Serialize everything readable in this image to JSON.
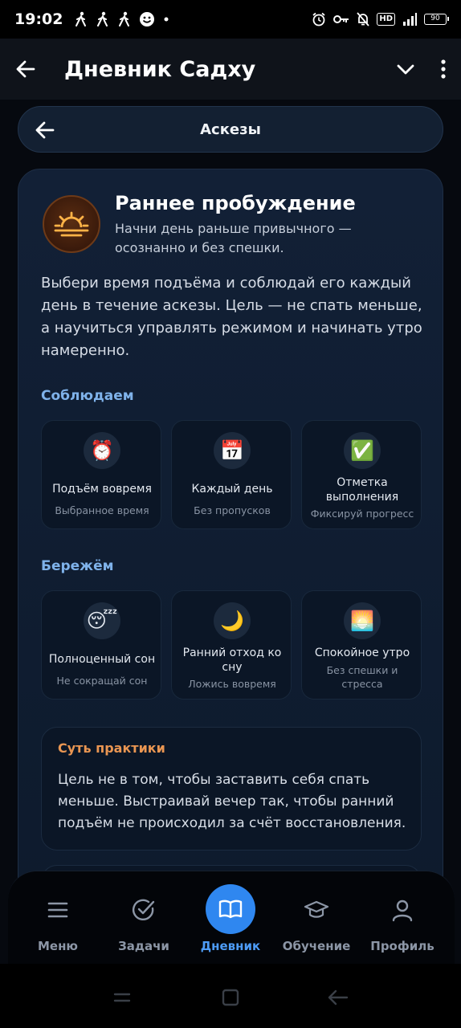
{
  "status": {
    "time": "19:02",
    "battery": "90",
    "network": "HD"
  },
  "appbar": {
    "title": "Дневник Садху"
  },
  "pill": {
    "title": "Аскезы"
  },
  "hero": {
    "title": "Раннее пробуждение",
    "subtitle": "Начни день раньше привычного — осознанно и без спешки."
  },
  "description": "Выбери время подъёма и соблюдай его каждый день в течение аскезы. Цель — не спать меньше, а научиться управлять режимом и начинать утро намеренно.",
  "observe": {
    "label": "Соблюдаем",
    "tiles": [
      {
        "icon": "⏰",
        "title": "Подъём вовремя",
        "sub": "Выбранное время"
      },
      {
        "icon": "📅",
        "title": "Каждый день",
        "sub": "Без пропусков"
      },
      {
        "icon": "✅",
        "title": "Отметка выполнения",
        "sub": "Фиксируй прогресс"
      }
    ]
  },
  "protect": {
    "label": "Бережём",
    "tiles": [
      {
        "icon": "😴",
        "title": "Полноценный сон",
        "sub": "Не сокращай сон"
      },
      {
        "icon": "🌙",
        "title": "Ранний отход ко сну",
        "sub": "Ложись вовремя"
      },
      {
        "icon": "🌅",
        "title": "Спокойное утро",
        "sub": "Без спешки и стресса"
      }
    ]
  },
  "essence": {
    "title": "Суть практики",
    "text": "Цель не в том, чтобы заставить себя спать меньше. Выстраивай вечер так, чтобы ранний подъём не происходил за счёт восстановления."
  },
  "nav": {
    "items": [
      {
        "label": "Меню"
      },
      {
        "label": "Задачи"
      },
      {
        "label": "Дневник"
      },
      {
        "label": "Обучение"
      },
      {
        "label": "Профиль"
      }
    ]
  },
  "colors": {
    "accent": "#2f87f0",
    "section": "#7fb2ea",
    "essence": "#ea9652"
  }
}
